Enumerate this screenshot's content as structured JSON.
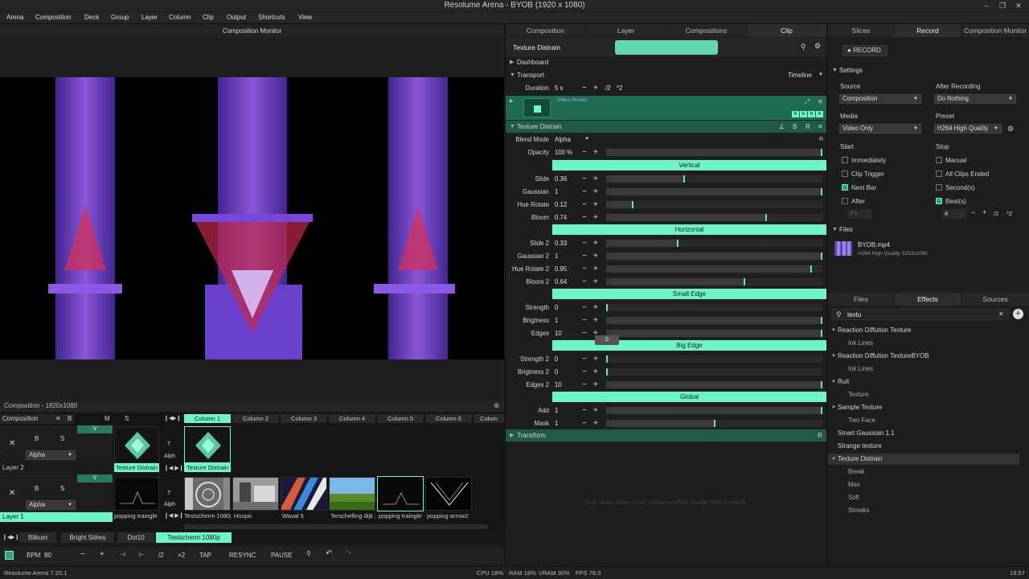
{
  "window": {
    "title": "Resolume Arena - BYOB (1920 x 1080)"
  },
  "menu": [
    "Arena",
    "Composition",
    "Deck",
    "Group",
    "Layer",
    "Column",
    "Clip",
    "Output",
    "Shortcuts",
    "View"
  ],
  "monitor": {
    "title": "Composition Monitor"
  },
  "composition": {
    "label": "Composition - 1920x1080"
  },
  "grid": {
    "comp_name": "Composition",
    "columns": [
      "Column 1",
      "Column 2",
      "Column 3",
      "Column 4",
      "Column 5",
      "Column 6",
      "Colum"
    ],
    "layers": [
      {
        "name": "Layer 2",
        "blend": "Alpha",
        "clips": [
          "Texture Distrain",
          "Texture Distrain"
        ]
      },
      {
        "name": "Layer 1",
        "blend": "Alpha",
        "clips": [
          "popping traingle",
          "Testscherm 1080p",
          "Hospic",
          "Waval 5",
          "Terschelling dijk 2",
          "popping traingle",
          "popping arrow2"
        ]
      }
    ],
    "btn_x": "✕",
    "btn_b": "B",
    "btn_s": "S",
    "btn_m": "M",
    "btn_v": "V",
    "btn_t": "T",
    "btn_alph": "Alph"
  },
  "decks": [
    "Blikum",
    "Bright Stikes",
    "Dot10",
    "Testscherm 1080p"
  ],
  "transport_bar": {
    "bpm_label": "BPM",
    "bpm": "80",
    "minus": "−",
    "plus": "+",
    "half": "/2",
    "double": "×2",
    "tap": "TAP",
    "resync": "RESYNC",
    "pause": "PAUSE"
  },
  "status": {
    "version": "Resolume Arena 7.20.1",
    "cpu": "CPU 18%",
    "ram": "RAM 18%",
    "vram": "VRAM 30%",
    "fps": "FPS 78.0",
    "time": "19:57"
  },
  "clip_panel": {
    "tabs": [
      "Composition",
      "Layer",
      "Compositions",
      "Clip"
    ],
    "clip_name": "Texture Distrain",
    "dashboard": "Dashboard",
    "transport": "Transport",
    "timeline": "Timeline",
    "duration_label": "Duration",
    "duration_value": "5 s",
    "duration_half": "/2",
    "duration_double": "*2",
    "video_router": "Video Router",
    "rgba": [
      "R",
      "G",
      "B",
      "A"
    ],
    "effect_name": "Texture Distrain",
    "blend_label": "Blend Mode",
    "blend_value": "Alpha",
    "opacity_label": "Opacity",
    "opacity_value": "100 %",
    "opacity_level": 1.0,
    "groups": [
      {
        "title": "Vertical",
        "params": [
          {
            "label": "Slide",
            "value": "0.36",
            "level": 0.36
          },
          {
            "label": "Gaussian",
            "value": "1",
            "level": 1.0
          },
          {
            "label": "Hue Rotate",
            "value": "0.12",
            "level": 0.12
          },
          {
            "label": "Bloom",
            "value": "0.74",
            "level": 0.74
          }
        ]
      },
      {
        "title": "Horizontal",
        "params": [
          {
            "label": "Slide 2",
            "value": "0.33",
            "level": 0.33
          },
          {
            "label": "Gaussian 2",
            "value": "1",
            "level": 1.0
          },
          {
            "label": "Hue Rotate 2",
            "value": "0.95",
            "level": 0.95
          },
          {
            "label": "Bloom 2",
            "value": "0.64",
            "level": 0.64
          }
        ]
      },
      {
        "title": "Small Edge",
        "params": [
          {
            "label": "Strength",
            "value": "0",
            "level": 0.0
          },
          {
            "label": "Brigtness",
            "value": "1",
            "level": 1.0
          },
          {
            "label": "Edges",
            "value": "10",
            "level": 1.0
          }
        ]
      },
      {
        "title": "Big Edge",
        "params": [
          {
            "label": "Strength 2",
            "value": "0",
            "level": 0.0
          },
          {
            "label": "Brigtness 2",
            "value": "0",
            "level": 0.0
          },
          {
            "label": "Edges 2",
            "value": "10",
            "level": 1.0
          }
        ]
      },
      {
        "title": "Global",
        "params": [
          {
            "label": "Add",
            "value": "1",
            "level": 1.0
          },
          {
            "label": "Mask",
            "value": "1",
            "level": 0.5
          }
        ]
      }
    ],
    "transform": "Transform",
    "tooltip_value": "0",
    "drop_hint": "Drop audio, video, mask, source or effect. Double click to search."
  },
  "right_panel": {
    "tabs": [
      "Slices",
      "Record",
      "Composition Monitor"
    ],
    "record_btn": "RECORD",
    "settings": "Settings",
    "source_label": "Source",
    "source_value": "Composition",
    "after_label": "After Recording",
    "after_value": "Do Nothing",
    "media_label": "Media",
    "media_value": "Video Only",
    "preset_label": "Preset",
    "preset_value": "H264 High Quality",
    "start_label": "Start",
    "stop_label": "Stop",
    "start_opts": [
      {
        "label": "Immediately",
        "on": false
      },
      {
        "label": "Clip Trigger",
        "on": false
      },
      {
        "label": "Next Bar",
        "on": true
      },
      {
        "label": "After",
        "on": false
      }
    ],
    "stop_opts": [
      {
        "label": "Manual",
        "on": false
      },
      {
        "label": "All Clips Ended",
        "on": false
      },
      {
        "label": "Second(s)",
        "on": false
      },
      {
        "label": "Beat(s)",
        "on": true
      }
    ],
    "after_value_field": "3 s",
    "beats_value": "4",
    "beats_half": "/2",
    "beats_double": "*2",
    "files_label": "Files",
    "file_name": "BYOB.mp4",
    "file_desc": "H264 High Quality 1920x1080",
    "lower_tabs": [
      "Files",
      "Effects",
      "Sources"
    ],
    "search_value": "textu",
    "effects": [
      {
        "name": "Reaction Diffution Texture",
        "children": [
          "Ink Lines"
        ]
      },
      {
        "name": "Reaction Diffution TextureBYOB",
        "children": [
          "Ink Lines"
        ]
      },
      {
        "name": "Ruit",
        "children": [
          "Texture"
        ]
      },
      {
        "name": "Sample Texture",
        "children": [
          "Two Face"
        ]
      },
      {
        "name": "Smart Gaussian 1.1",
        "children": []
      },
      {
        "name": "Strange texture",
        "children": []
      },
      {
        "name": "Texture Distrain",
        "children": [
          "Break",
          "Max",
          "Soft",
          "Streaks"
        ]
      }
    ]
  },
  "colors": {
    "accent": "#6ef5c6",
    "bg": "#1b1b1b",
    "panel": "#1e1e1e"
  }
}
